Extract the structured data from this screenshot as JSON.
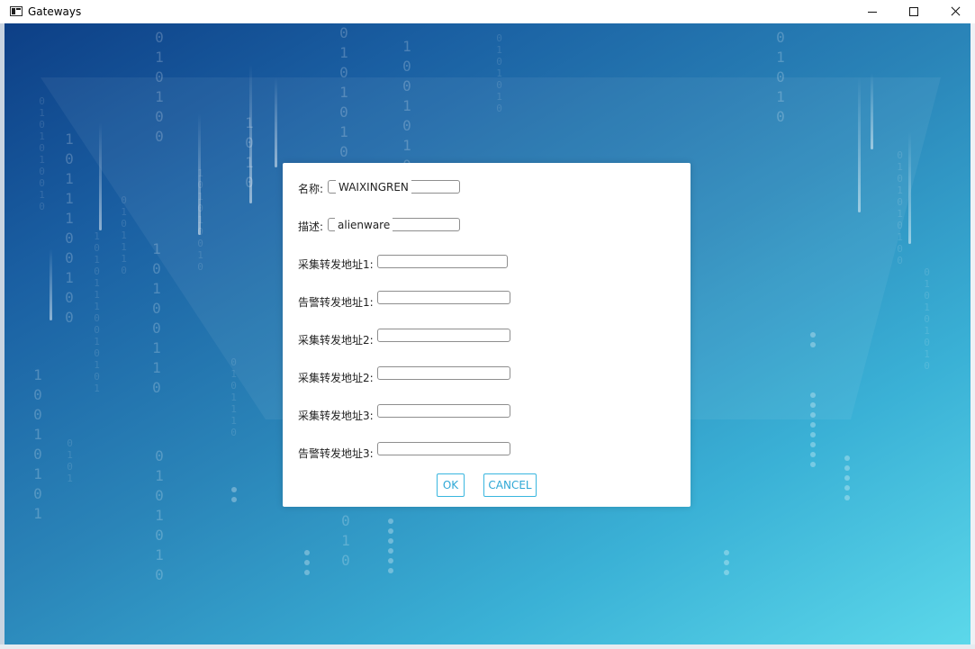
{
  "window": {
    "title": "Gateways"
  },
  "form": {
    "fields": [
      {
        "label": "名称:",
        "value": "WAIXINGREN"
      },
      {
        "label": "描述:",
        "value": "alienware"
      },
      {
        "label": "采集转发地址1:",
        "value": ""
      },
      {
        "label": "告警转发地址1:",
        "value": ""
      },
      {
        "label": "采集转发地址2:",
        "value": ""
      },
      {
        "label": "采集转发地址2:",
        "value": ""
      },
      {
        "label": "采集转发地址3:",
        "value": ""
      },
      {
        "label": "告警转发地址3:",
        "value": ""
      }
    ],
    "ok_label": "OK",
    "cancel_label": "CANCEL"
  },
  "theme": {
    "accent": "#39b6df",
    "bg_start": "#0d3f86",
    "bg_end": "#5cd8ea"
  },
  "icons": {
    "window_controls": [
      "minimize-icon",
      "maximize-icon",
      "close-icon"
    ]
  }
}
